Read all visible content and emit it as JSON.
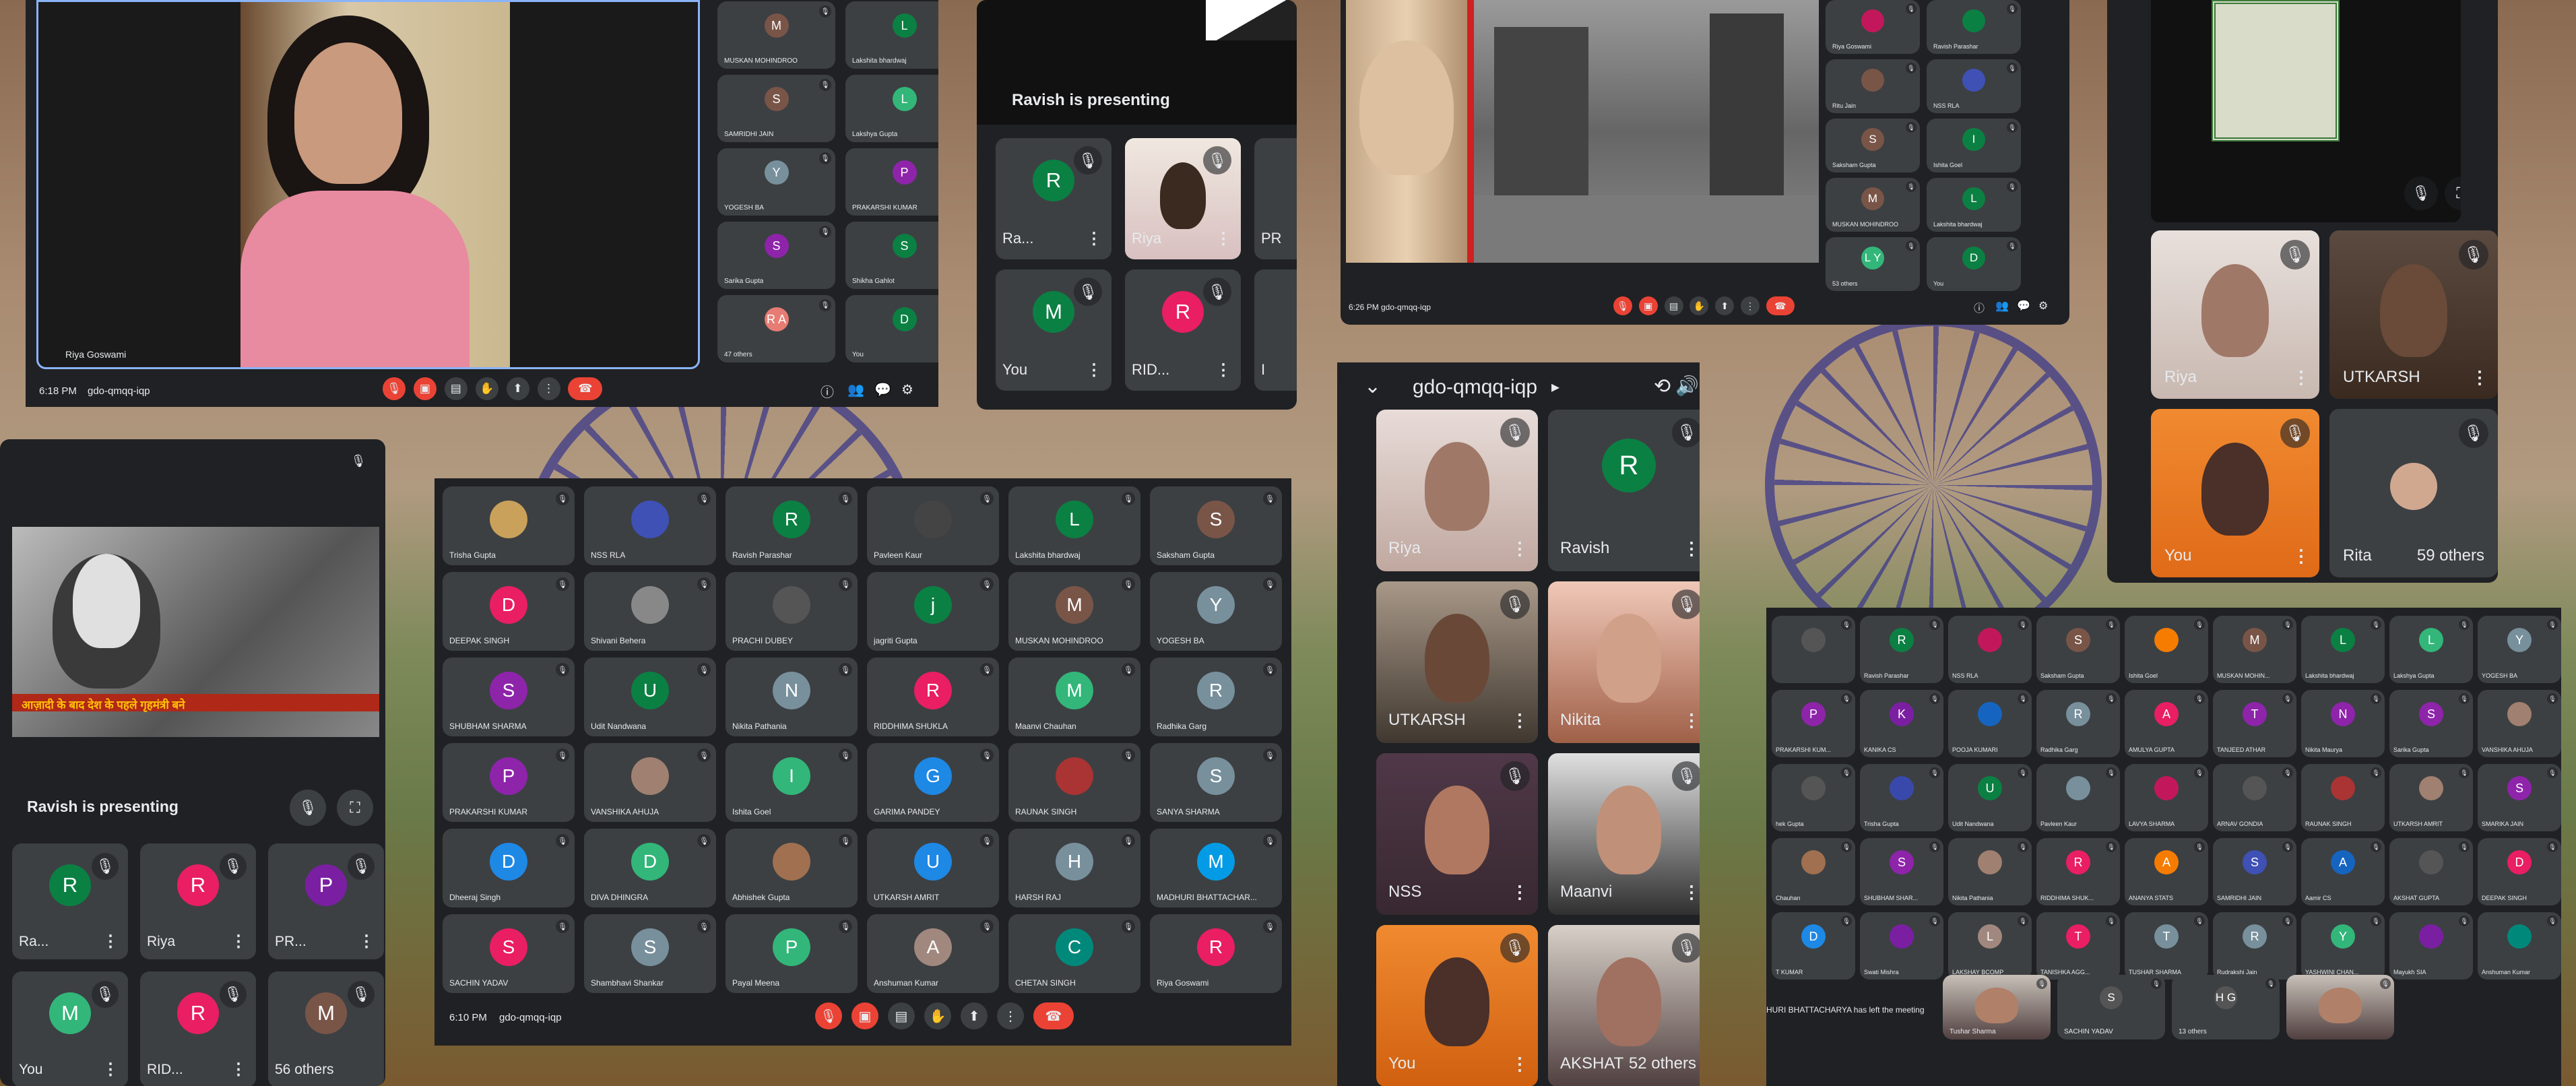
{
  "colors": {
    "meet_bg": "#202124",
    "tile": "#3c4043",
    "red": "#ea4335",
    "blue": "#8ab4f8"
  },
  "p1": {
    "time": "6:18 PM",
    "code": "gdo-qmqq-iqp",
    "presenter": "Riya Goswami",
    "tiles": [
      {
        "l": "M",
        "n": "MUSKAN MOHINDROO",
        "c": "#795548"
      },
      {
        "l": "L",
        "n": "Lakshita bhardwaj",
        "c": "#0b8043"
      },
      {
        "l": "S",
        "n": "SAMRIDHI JAIN",
        "c": "#795548"
      },
      {
        "l": "L",
        "n": "Lakshya Gupta",
        "c": "#33b679"
      },
      {
        "l": "Y",
        "n": "YOGESH BA",
        "c": "#78909c"
      },
      {
        "l": "P",
        "n": "PRAKARSHI KUMAR",
        "c": "#8e24aa"
      },
      {
        "l": "S",
        "n": "Sarika Gupta",
        "c": "#8e24aa"
      },
      {
        "l": "S",
        "n": "Shikha Gahlot",
        "c": "#0b8043"
      },
      {
        "l": "R A",
        "n": "47 others",
        "c": "#e67c73"
      },
      {
        "l": "D",
        "n": "You",
        "c": "#0b8043"
      }
    ]
  },
  "p2": {
    "presenting": "Ravish is presenting",
    "tiles": [
      {
        "l": "R",
        "n": "Ra...",
        "c": "#0b8043"
      },
      {
        "l": "",
        "n": "Riya",
        "c": ""
      },
      {
        "l": "",
        "n": "PR",
        "c": ""
      },
      {
        "l": "M",
        "n": "You",
        "c": "#0b8043"
      },
      {
        "l": "R",
        "n": "RID...",
        "c": "#e91e63"
      },
      {
        "l": "",
        "n": "I",
        "c": ""
      }
    ]
  },
  "p3": {
    "time": "6:26 PM",
    "code": "gdo-qmqq-iqp",
    "list": [
      {
        "n": "Riya Goswami",
        "l": "",
        "c": "#c2185b"
      },
      {
        "n": "Ravish Parashar",
        "l": "",
        "c": "#0b8043"
      },
      {
        "n": "Ritu Jain",
        "l": "",
        "c": "#795548"
      },
      {
        "n": "NSS RLA",
        "l": "",
        "c": "#3f51b5"
      },
      {
        "n": "Saksham Gupta",
        "l": "S",
        "c": "#795548"
      },
      {
        "n": "Ishita Goel",
        "l": "I",
        "c": "#0b8043"
      },
      {
        "n": "MUSKAN MOHINDROO",
        "l": "M",
        "c": "#795548"
      },
      {
        "n": "Lakshita bhardwaj",
        "l": "L",
        "c": "#0b8043"
      },
      {
        "n": "53 others",
        "l": "L Y",
        "c": "#33b679"
      },
      {
        "n": "You",
        "l": "D",
        "c": "#0b8043"
      }
    ]
  },
  "p4": {
    "tiles": [
      {
        "n": "Riya"
      },
      {
        "n": "UTKARSH"
      },
      {
        "n": "You"
      },
      {
        "n": "Rita",
        "extra": "59 others"
      }
    ]
  },
  "p5": {
    "presenting": "Ravish is presenting",
    "caption": "आज़ादी के बाद देश के पहले गृहमंत्री बने",
    "tiles": [
      {
        "l": "R",
        "n": "Ra...",
        "c": "#0b8043"
      },
      {
        "l": "R",
        "n": "Riya",
        "c": "#e91e63"
      },
      {
        "l": "P",
        "n": "PR...",
        "c": "#7b1fa2"
      },
      {
        "l": "M",
        "n": "You",
        "c": "#33b679"
      },
      {
        "l": "R",
        "n": "RID...",
        "c": "#e91e63"
      },
      {
        "l": "M",
        "n": "56 others",
        "c": "#795548"
      }
    ]
  },
  "p6": {
    "time": "6:10 PM",
    "code": "gdo-qmqq-iqp",
    "tiles": [
      {
        "l": "",
        "n": "Trisha Gupta",
        "c": "#c9a15a"
      },
      {
        "l": "",
        "n": "NSS RLA",
        "c": "#3f51b5"
      },
      {
        "l": "R",
        "n": "Ravish Parashar",
        "c": "#0b8043"
      },
      {
        "l": "",
        "n": "Pavleen Kaur",
        "c": "#444"
      },
      {
        "l": "L",
        "n": "Lakshita bhardwaj",
        "c": "#0b8043"
      },
      {
        "l": "S",
        "n": "Saksham Gupta",
        "c": "#795548"
      },
      {
        "l": "D",
        "n": "DEEPAK SINGH",
        "c": "#e91e63"
      },
      {
        "l": "",
        "n": "Shivani Behera",
        "c": "#888"
      },
      {
        "l": "",
        "n": "PRACHI DUBEY",
        "c": "#555"
      },
      {
        "l": "j",
        "n": "jagriti Gupta",
        "c": "#0b8043"
      },
      {
        "l": "M",
        "n": "MUSKAN MOHINDROO",
        "c": "#795548"
      },
      {
        "l": "Y",
        "n": "YOGESH BA",
        "c": "#78909c"
      },
      {
        "l": "S",
        "n": "SHUBHAM SHARMA",
        "c": "#8e24aa"
      },
      {
        "l": "U",
        "n": "Udit Nandwana",
        "c": "#0b8043"
      },
      {
        "l": "N",
        "n": "Nikita Pathania",
        "c": "#78909c"
      },
      {
        "l": "R",
        "n": "RIDDHIMA SHUKLA",
        "c": "#e91e63"
      },
      {
        "l": "M",
        "n": "Maanvi Chauhan",
        "c": "#33b679"
      },
      {
        "l": "R",
        "n": "Radhika Garg",
        "c": "#78909c"
      },
      {
        "l": "P",
        "n": "PRAKARSHI KUMAR",
        "c": "#8e24aa"
      },
      {
        "l": "",
        "n": "VANSHIKA AHUJA",
        "c": "#a08070"
      },
      {
        "l": "I",
        "n": "Ishita Goel",
        "c": "#33b679"
      },
      {
        "l": "G",
        "n": "GARIMA PANDEY",
        "c": "#1e88e5"
      },
      {
        "l": "",
        "n": "RAUNAK SINGH",
        "c": "#a33"
      },
      {
        "l": "S",
        "n": "SANYA SHARMA",
        "c": "#78909c"
      },
      {
        "l": "D",
        "n": "Dheeraj Singh",
        "c": "#1e88e5"
      },
      {
        "l": "D",
        "n": "DIVA DHINGRA",
        "c": "#33b679"
      },
      {
        "l": "",
        "n": "Abhishek Gupta",
        "c": "#a07050"
      },
      {
        "l": "U",
        "n": "UTKARSH AMRIT",
        "c": "#1e88e5"
      },
      {
        "l": "H",
        "n": "HARSH RAJ",
        "c": "#78909c"
      },
      {
        "l": "M",
        "n": "MADHURI BHATTACHAR...",
        "c": "#039be5"
      },
      {
        "l": "S",
        "n": "SACHIN YADAV",
        "c": "#e91e63"
      },
      {
        "l": "S",
        "n": "Shambhavi Shankar",
        "c": "#78909c"
      },
      {
        "l": "P",
        "n": "Payal Meena",
        "c": "#33b679"
      },
      {
        "l": "A",
        "n": "Anshuman Kumar",
        "c": "#a1887f"
      },
      {
        "l": "C",
        "n": "CHETAN SINGH",
        "c": "#00897b"
      },
      {
        "l": "R",
        "n": "Riya Goswami",
        "c": "#e91e63"
      }
    ]
  },
  "p7": {
    "title": "gdo-qmqq-iqp",
    "chevron": "▸",
    "tiles": [
      {
        "n": "Riya",
        "l": ""
      },
      {
        "n": "Ravish",
        "l": "R"
      },
      {
        "n": "UTKARSH",
        "l": ""
      },
      {
        "n": "Nikita",
        "l": ""
      },
      {
        "n": "NSS",
        "l": ""
      },
      {
        "n": "Maanvi",
        "l": ""
      },
      {
        "n": "You",
        "l": ""
      },
      {
        "n": "AKSHAT",
        "l": "",
        "extra": "52 others"
      }
    ]
  },
  "p8": {
    "left_notice": "HURI BHATTACHARYA has left the meeting",
    "tiles": [
      {
        "l": "",
        "n": "",
        "c": "#555"
      },
      {
        "l": "R",
        "n": "Ravish Parashar",
        "c": "#0b8043"
      },
      {
        "l": "",
        "n": "NSS RLA",
        "c": "#c2185b"
      },
      {
        "l": "S",
        "n": "Saksham Gupta",
        "c": "#795548"
      },
      {
        "l": "",
        "n": "Ishita Goel",
        "c": "#f57c00"
      },
      {
        "l": "M",
        "n": "MUSKAN MOHIN...",
        "c": "#795548"
      },
      {
        "l": "L",
        "n": "Lakshita bhardwaj",
        "c": "#0b8043"
      },
      {
        "l": "L",
        "n": "Lakshya Gupta",
        "c": "#33b679"
      },
      {
        "l": "Y",
        "n": "YOGESH BA",
        "c": "#78909c"
      },
      {
        "l": "P",
        "n": "PRAKARSHI KUM...",
        "c": "#8e24aa"
      },
      {
        "l": "K",
        "n": "KANIKA CS",
        "c": "#7b1fa2"
      },
      {
        "l": "",
        "n": "POOJA KUMARI",
        "c": "#1565c0"
      },
      {
        "l": "R",
        "n": "Radhika Garg",
        "c": "#78909c"
      },
      {
        "l": "A",
        "n": "AMULYA GUPTA",
        "c": "#e91e63"
      },
      {
        "l": "T",
        "n": "TANJEED ATHAR",
        "c": "#8e24aa"
      },
      {
        "l": "N",
        "n": "Nikita Maurya",
        "c": "#8e24aa"
      },
      {
        "l": "S",
        "n": "Sarika Gupta",
        "c": "#8e24aa"
      },
      {
        "l": "",
        "n": "VANSHIKA AHUJA",
        "c": "#a08070"
      },
      {
        "l": "",
        "n": "hek Gupta",
        "c": "#555"
      },
      {
        "l": "",
        "n": "Trisha Gupta",
        "c": "#3949ab"
      },
      {
        "l": "U",
        "n": "Udit Nandwana",
        "c": "#0b8043"
      },
      {
        "l": "",
        "n": "Pavleen Kaur",
        "c": "#78909c"
      },
      {
        "l": "",
        "n": "LAVYA SHARMA",
        "c": "#c2185b"
      },
      {
        "l": "",
        "n": "ARNAV GONDIA",
        "c": "#555"
      },
      {
        "l": "",
        "n": "RAUNAK SINGH",
        "c": "#a33"
      },
      {
        "l": "",
        "n": "UTKARSH AMRIT",
        "c": "#a08070"
      },
      {
        "l": "S",
        "n": "SMARIKA JAIN",
        "c": "#8e24aa"
      },
      {
        "l": "",
        "n": "Chauhan",
        "c": "#a07050"
      },
      {
        "l": "S",
        "n": "SHUBHAM SHAR...",
        "c": "#8e24aa"
      },
      {
        "l": "",
        "n": "Nikita Pathania",
        "c": "#a08070"
      },
      {
        "l": "R",
        "n": "RIDDHIMA SHUK...",
        "c": "#e91e63"
      },
      {
        "l": "A",
        "n": "ANANYA STATS",
        "c": "#f57c00"
      },
      {
        "l": "S",
        "n": "SAMRIDHI JAIN",
        "c": "#3f51b5"
      },
      {
        "l": "A",
        "n": "Aamir CS",
        "c": "#1565c0"
      },
      {
        "l": "",
        "n": "AKSHAT GUPTA",
        "c": "#555"
      },
      {
        "l": "D",
        "n": "DEEPAK SINGH",
        "c": "#e91e63"
      },
      {
        "l": "D",
        "n": "T KUMAR",
        "c": "#1e88e5"
      },
      {
        "l": "",
        "n": "Swati Mishra",
        "c": "#7b1fa2"
      },
      {
        "l": "L",
        "n": "LAKSHAY BCOMP",
        "c": "#a1887f"
      },
      {
        "l": "T",
        "n": "TANISHKA AGG...",
        "c": "#e91e63"
      },
      {
        "l": "T",
        "n": "TUSHAR SHARMA",
        "c": "#78909c"
      },
      {
        "l": "R",
        "n": "Rudrakshi Jain",
        "c": "#78909c"
      },
      {
        "l": "Y",
        "n": "YASHWINI CHAN...",
        "c": "#33b679"
      },
      {
        "l": "",
        "n": "Mayukh SIA",
        "c": "#7b1fa2"
      },
      {
        "l": "",
        "n": "Anshuman Kumar",
        "c": "#00897b"
      }
    ],
    "bottom": [
      {
        "n": "Tushar Sharma"
      },
      {
        "n": "SACHIN YADAV",
        "l": "S"
      },
      {
        "n": "13 others",
        "l": "H G"
      },
      {
        "n": ""
      }
    ]
  }
}
